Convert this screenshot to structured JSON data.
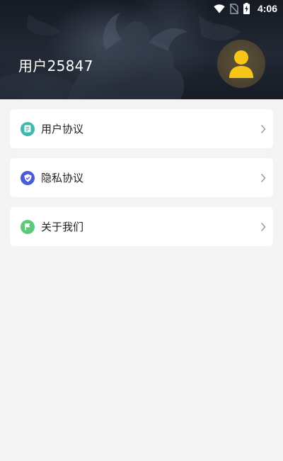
{
  "status_bar": {
    "time": "4:06",
    "icons": [
      "wifi-icon",
      "no-sim-icon",
      "battery-charging-icon"
    ]
  },
  "profile": {
    "username": "用户25847",
    "avatar_icon": "user-avatar-icon",
    "avatar_color": "#f5c518"
  },
  "menu": {
    "items": [
      {
        "label": "用户协议",
        "icon": "document-icon",
        "icon_color": "#3fb9b0"
      },
      {
        "label": "隐私协议",
        "icon": "shield-icon",
        "icon_color": "#4a5bd6"
      },
      {
        "label": "关于我们",
        "icon": "flag-icon",
        "icon_color": "#5cc97a"
      }
    ],
    "chevron_icon": "chevron-right-icon"
  },
  "colors": {
    "page_background": "#f4f4f4",
    "card_background": "#ffffff",
    "header_background": "#1c222c"
  }
}
